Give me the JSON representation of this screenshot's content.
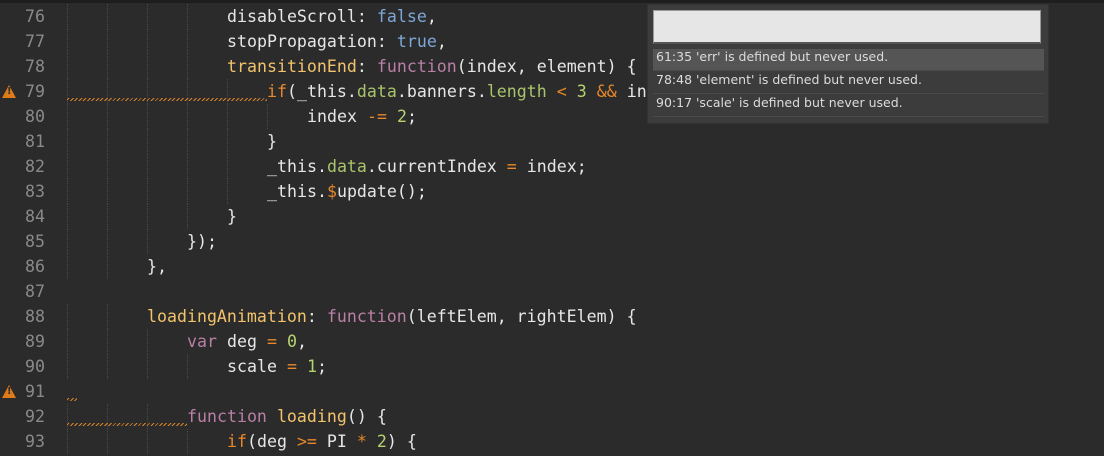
{
  "editor": {
    "lines": [
      {
        "num": "76",
        "warn": false,
        "indent": 16,
        "tokens": [
          [
            "disableScroll",
            "plain"
          ],
          [
            ": ",
            "plain"
          ],
          [
            "false",
            "bool"
          ],
          [
            ",",
            "plain"
          ]
        ]
      },
      {
        "num": "77",
        "warn": false,
        "indent": 16,
        "tokens": [
          [
            "stopPropagation",
            "plain"
          ],
          [
            ": ",
            "plain"
          ],
          [
            "true",
            "bool"
          ],
          [
            ",",
            "plain"
          ]
        ]
      },
      {
        "num": "78",
        "warn": false,
        "indent": 16,
        "tokens": [
          [
            "transitionEnd",
            "prop"
          ],
          [
            ": ",
            "plain"
          ],
          [
            "function",
            "kw"
          ],
          [
            "(index, element) {",
            "plain"
          ]
        ]
      },
      {
        "num": "79",
        "warn": true,
        "squiggle": 20,
        "indent": 20,
        "tokens": [
          [
            "if",
            "op"
          ],
          [
            "(_this.",
            "plain"
          ],
          [
            "data",
            "mem"
          ],
          [
            ".banners.",
            "plain"
          ],
          [
            "length",
            "mem"
          ],
          [
            " ",
            "plain"
          ],
          [
            "<",
            "op"
          ],
          [
            " ",
            "plain"
          ],
          [
            "3",
            "num"
          ],
          [
            " ",
            "plain"
          ],
          [
            "&&",
            "op"
          ],
          [
            " in",
            "plain"
          ]
        ]
      },
      {
        "num": "80",
        "warn": false,
        "indent": 24,
        "tokens": [
          [
            "index ",
            "plain"
          ],
          [
            "-=",
            "op"
          ],
          [
            " ",
            "plain"
          ],
          [
            "2",
            "num"
          ],
          [
            ";",
            "plain"
          ]
        ]
      },
      {
        "num": "81",
        "warn": false,
        "indent": 20,
        "tokens": [
          [
            "}",
            "plain"
          ]
        ]
      },
      {
        "num": "82",
        "warn": false,
        "indent": 20,
        "tokens": [
          [
            "_this.",
            "plain"
          ],
          [
            "data",
            "mem"
          ],
          [
            ".currentIndex ",
            "plain"
          ],
          [
            "=",
            "op"
          ],
          [
            " index;",
            "plain"
          ]
        ]
      },
      {
        "num": "83",
        "warn": false,
        "indent": 20,
        "tokens": [
          [
            "_this.",
            "plain"
          ],
          [
            "$",
            "op"
          ],
          [
            "update();",
            "plain"
          ]
        ]
      },
      {
        "num": "84",
        "warn": false,
        "indent": 16,
        "tokens": [
          [
            "}",
            "plain"
          ]
        ]
      },
      {
        "num": "85",
        "warn": false,
        "indent": 12,
        "tokens": [
          [
            "});",
            "plain"
          ]
        ]
      },
      {
        "num": "86",
        "warn": false,
        "indent": 8,
        "tokens": [
          [
            "},",
            "plain"
          ]
        ]
      },
      {
        "num": "87",
        "warn": false,
        "indent": 0,
        "tokens": []
      },
      {
        "num": "88",
        "warn": false,
        "indent": 8,
        "tokens": [
          [
            "loadingAnimation",
            "prop"
          ],
          [
            ": ",
            "plain"
          ],
          [
            "function",
            "kw"
          ],
          [
            "(leftElem, rightElem) {",
            "plain"
          ]
        ]
      },
      {
        "num": "89",
        "warn": false,
        "indent": 12,
        "tokens": [
          [
            "var",
            "kw"
          ],
          [
            " deg ",
            "plain"
          ],
          [
            "=",
            "op"
          ],
          [
            " ",
            "plain"
          ],
          [
            "0",
            "num"
          ],
          [
            ",",
            "plain"
          ]
        ]
      },
      {
        "num": "90",
        "warn": false,
        "indent": 16,
        "tokens": [
          [
            "scale ",
            "plain"
          ],
          [
            "=",
            "op"
          ],
          [
            " ",
            "plain"
          ],
          [
            "1",
            "num"
          ],
          [
            ";",
            "plain"
          ]
        ]
      },
      {
        "num": "91",
        "warn": true,
        "squiggle": 1,
        "indent": 0,
        "tokens": []
      },
      {
        "num": "92",
        "warn": false,
        "squiggle": 12,
        "indent": 12,
        "tokens": [
          [
            "function",
            "kw"
          ],
          [
            " ",
            "plain"
          ],
          [
            "loading",
            "fn"
          ],
          [
            "() {",
            "plain"
          ]
        ]
      },
      {
        "num": "93",
        "warn": false,
        "indent": 16,
        "tokens": [
          [
            "if",
            "op"
          ],
          [
            "(deg ",
            "plain"
          ],
          [
            ">=",
            "op"
          ],
          [
            " PI ",
            "plain"
          ],
          [
            "*",
            "op"
          ],
          [
            " ",
            "plain"
          ],
          [
            "2",
            "num"
          ],
          [
            ") {",
            "plain"
          ]
        ]
      }
    ]
  },
  "lint_popup": {
    "search_value": "",
    "items": [
      {
        "text": "61:35 'err' is defined but never used.",
        "selected": true
      },
      {
        "text": "78:48 'element' is defined but never used.",
        "selected": false
      },
      {
        "text": "90:17 'scale' is defined but never used.",
        "selected": false
      }
    ]
  }
}
